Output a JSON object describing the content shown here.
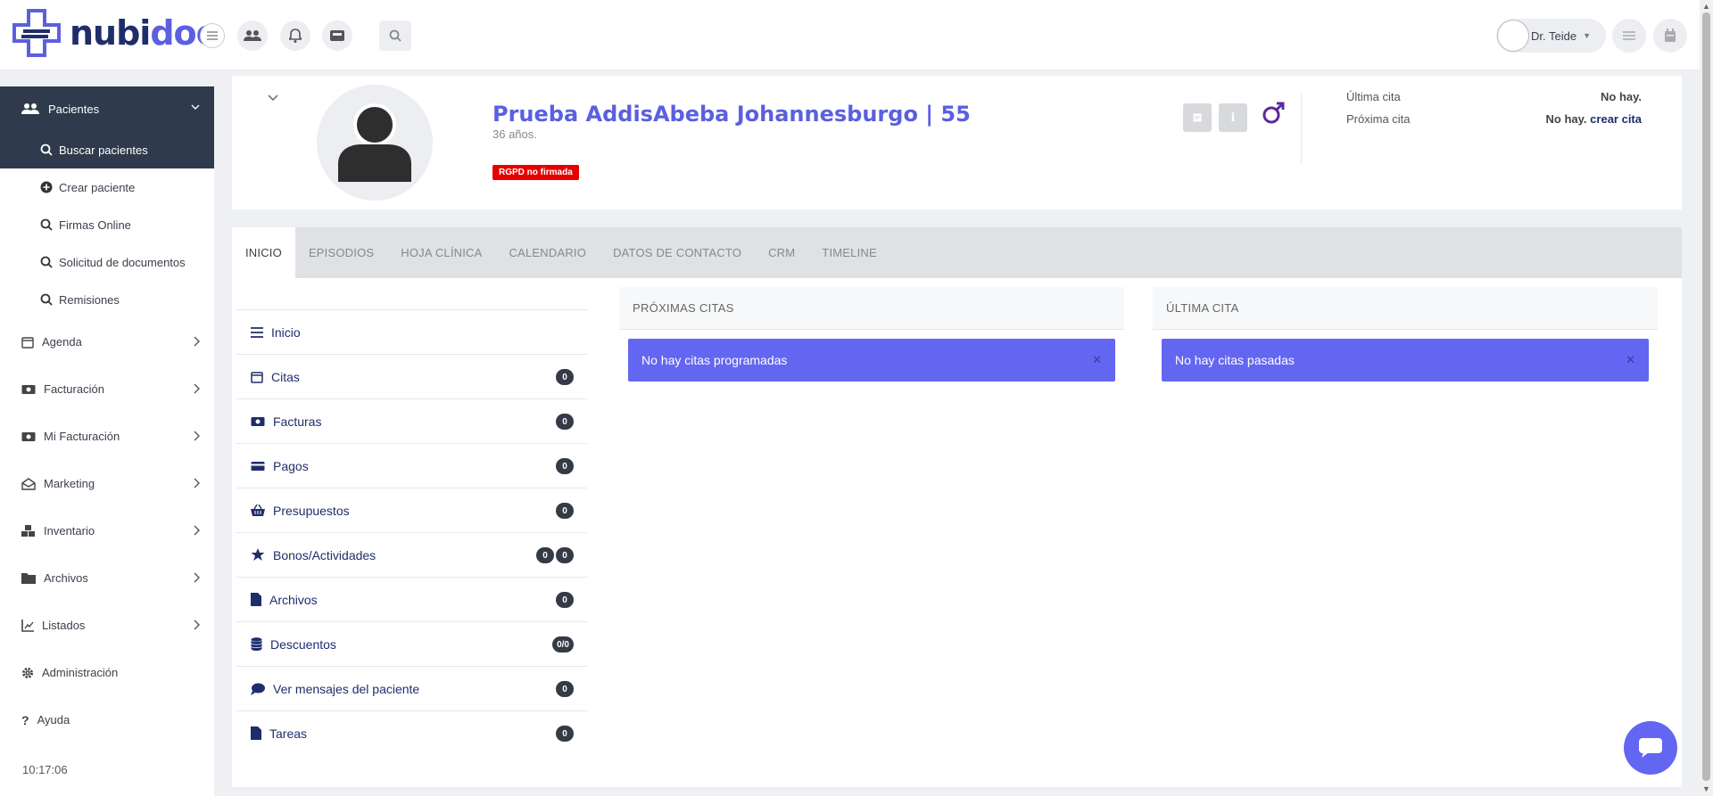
{
  "app": {
    "logo": {
      "part1": "nubi",
      "part2": "doc"
    },
    "user": {
      "name": "Dr. Teide"
    }
  },
  "sidebar": {
    "section": {
      "label": "Pacientes"
    },
    "subitems": [
      {
        "label": "Buscar pacientes"
      },
      {
        "label": "Crear paciente"
      },
      {
        "label": "Firmas Online"
      },
      {
        "label": "Solicitud de documentos"
      },
      {
        "label": "Remisiones"
      }
    ],
    "items": [
      {
        "label": "Agenda"
      },
      {
        "label": "Facturación"
      },
      {
        "label": "Mi Facturación"
      },
      {
        "label": "Marketing"
      },
      {
        "label": "Inventario"
      },
      {
        "label": "Archivos"
      },
      {
        "label": "Listados"
      },
      {
        "label": "Administración"
      },
      {
        "label": "Ayuda"
      }
    ],
    "clock": "10:17:06"
  },
  "patient": {
    "name": "Prueba AddisAbeba Johannesburgo | 55",
    "age": "36 años.",
    "rgpd_badge": "RGPD no firmada",
    "ultima_cita_label": "Última cita",
    "ultima_cita_value": "No hay.",
    "proxima_cita_label": "Próxima cita",
    "proxima_cita_value": "No hay.",
    "crear_cita_link": "crear cita"
  },
  "tabs": [
    {
      "label": "INICIO"
    },
    {
      "label": "EPISODIOS"
    },
    {
      "label": "HOJA CLÍNICA"
    },
    {
      "label": "CALENDARIO"
    },
    {
      "label": "DATOS DE CONTACTO"
    },
    {
      "label": "CRM"
    },
    {
      "label": "TIMELINE"
    }
  ],
  "menu": [
    {
      "label": "Inicio"
    },
    {
      "label": "Citas",
      "badge": "0"
    },
    {
      "label": "Facturas",
      "badge": "0"
    },
    {
      "label": "Pagos",
      "badge": "0"
    },
    {
      "label": "Presupuestos",
      "badge": "0"
    },
    {
      "label": "Bonos/Actividades",
      "badge": "0",
      "badge2": "0"
    },
    {
      "label": "Archivos",
      "badge": "0"
    },
    {
      "label": "Descuentos",
      "badge": "0/0"
    },
    {
      "label": "Ver mensajes del paciente",
      "badge": "0"
    },
    {
      "label": "Tareas",
      "badge": "0"
    }
  ],
  "panels": {
    "proximas": {
      "title": "PRÓXIMAS CITAS",
      "alert": "No hay citas programadas"
    },
    "ultima": {
      "title": "ÚLTIMA CITA",
      "alert": "No hay citas pasadas"
    }
  },
  "colors": {
    "accent": "#6366f1",
    "sidebar_active": "#2f3a4c",
    "brand_dark": "#1f2d6b",
    "rgpd": "#e60000"
  }
}
